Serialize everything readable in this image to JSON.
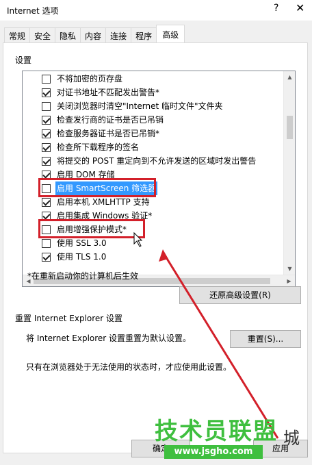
{
  "window": {
    "title": "Internet 选项",
    "help_glyph": "?",
    "close_glyph": "✕"
  },
  "tabs": [
    {
      "label": "常规",
      "active": false
    },
    {
      "label": "安全",
      "active": false
    },
    {
      "label": "隐私",
      "active": false
    },
    {
      "label": "内容",
      "active": false
    },
    {
      "label": "连接",
      "active": false
    },
    {
      "label": "程序",
      "active": false
    },
    {
      "label": "高级",
      "active": true
    }
  ],
  "settings": {
    "group_label": "设置",
    "items": [
      {
        "label": "不将加密的页存盘",
        "checked": false
      },
      {
        "label": "对证书地址不匹配发出警告*",
        "checked": true
      },
      {
        "label": "关闭浏览器时清空\"Internet 临时文件\"文件夹",
        "checked": false
      },
      {
        "label": "检查发行商的证书是否已吊销",
        "checked": true
      },
      {
        "label": "检查服务器证书是否已吊销*",
        "checked": true
      },
      {
        "label": "检查所下载程序的签名",
        "checked": true
      },
      {
        "label": "将提交的 POST 重定向到不允许发送的区域时发出警告",
        "checked": true
      },
      {
        "label": "启用 DOM 存储",
        "checked": true
      },
      {
        "label": "启用 SmartScreen 筛选器",
        "checked": false,
        "selected": true
      },
      {
        "label": "启用本机 XMLHTTP 支持",
        "checked": true
      },
      {
        "label": "启用集成 Windows 验证*",
        "checked": true
      },
      {
        "label": "启用增强保护模式*",
        "checked": false
      },
      {
        "label": "使用 SSL 3.0",
        "checked": false
      },
      {
        "label": "使用 TLS 1.0",
        "checked": true
      }
    ],
    "restart_note": "*在重新启动你的计算机后生效",
    "restore_button": "还原高级设置(R)"
  },
  "reset": {
    "group_label": "重置 Internet Explorer 设置",
    "description": "将 Internet Explorer 设置重置为默认设置。",
    "button": "重置(S)...",
    "note": "只有在浏览器处于无法使用的状态时，才应使用此设置。"
  },
  "footer": {
    "ok_button": "确定",
    "apply_button": "应用"
  },
  "watermark": {
    "brand": "技术员联盟",
    "url": "www.jsgho.com",
    "suffix": "城"
  },
  "colors": {
    "annotation_red": "#d3202a",
    "selection_blue": "#3399ff",
    "watermark_green": "#3fbf3f"
  }
}
